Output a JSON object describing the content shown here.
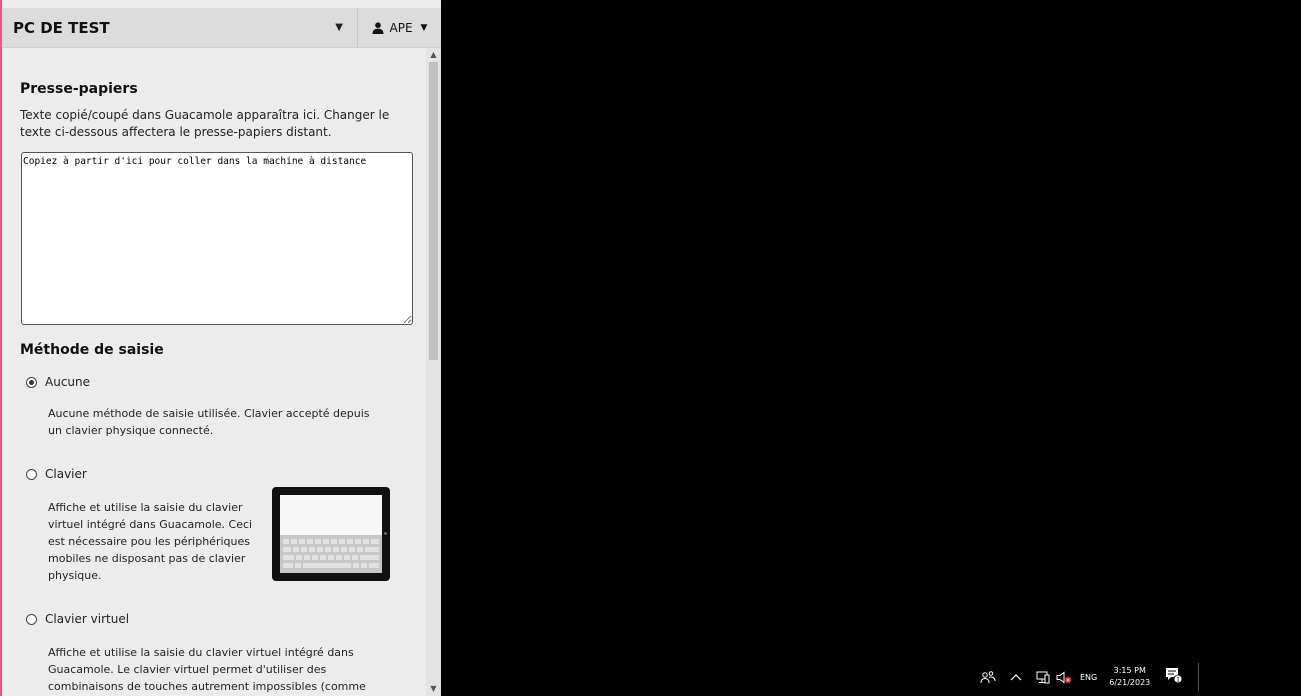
{
  "menu": {
    "connection_name": "PC DE TEST",
    "user_label": "APE"
  },
  "clipboard": {
    "heading": "Presse-papiers",
    "description": "Texte copié/coupé dans Guacamole apparaîtra ici. Changer le texte ci-dessous affectera le presse-papiers distant.",
    "value": "Copiez à partir d'ici pour coller dans la machine à distance"
  },
  "input_method": {
    "heading": "Méthode de saisie",
    "options": [
      {
        "label": "Aucune",
        "checked": true,
        "description": "Aucune méthode de saisie utilisée. Clavier accepté depuis un clavier physique connecté."
      },
      {
        "label": "Clavier",
        "checked": false,
        "description": "Affiche et utilise la saisie du clavier virtuel intégré dans Guacamole. Ceci est nécessaire pou les périphériques mobiles ne disposant pas de clavier physique."
      },
      {
        "label": "Clavier virtuel",
        "checked": false,
        "description": "Affiche et utilise la saisie du clavier virtuel intégré dans Guacamole. Le clavier virtuel permet d'utiliser des combinaisons de touches autrement impossibles (comme Ctrl-Alt-Supp)."
      }
    ]
  },
  "taskbar": {
    "language": "ENG",
    "time": "3:15 PM",
    "date": "6/21/2023",
    "notification_count": "1"
  },
  "colors": {
    "menu_accent": "#e0598b",
    "remote_background": "#000000"
  }
}
